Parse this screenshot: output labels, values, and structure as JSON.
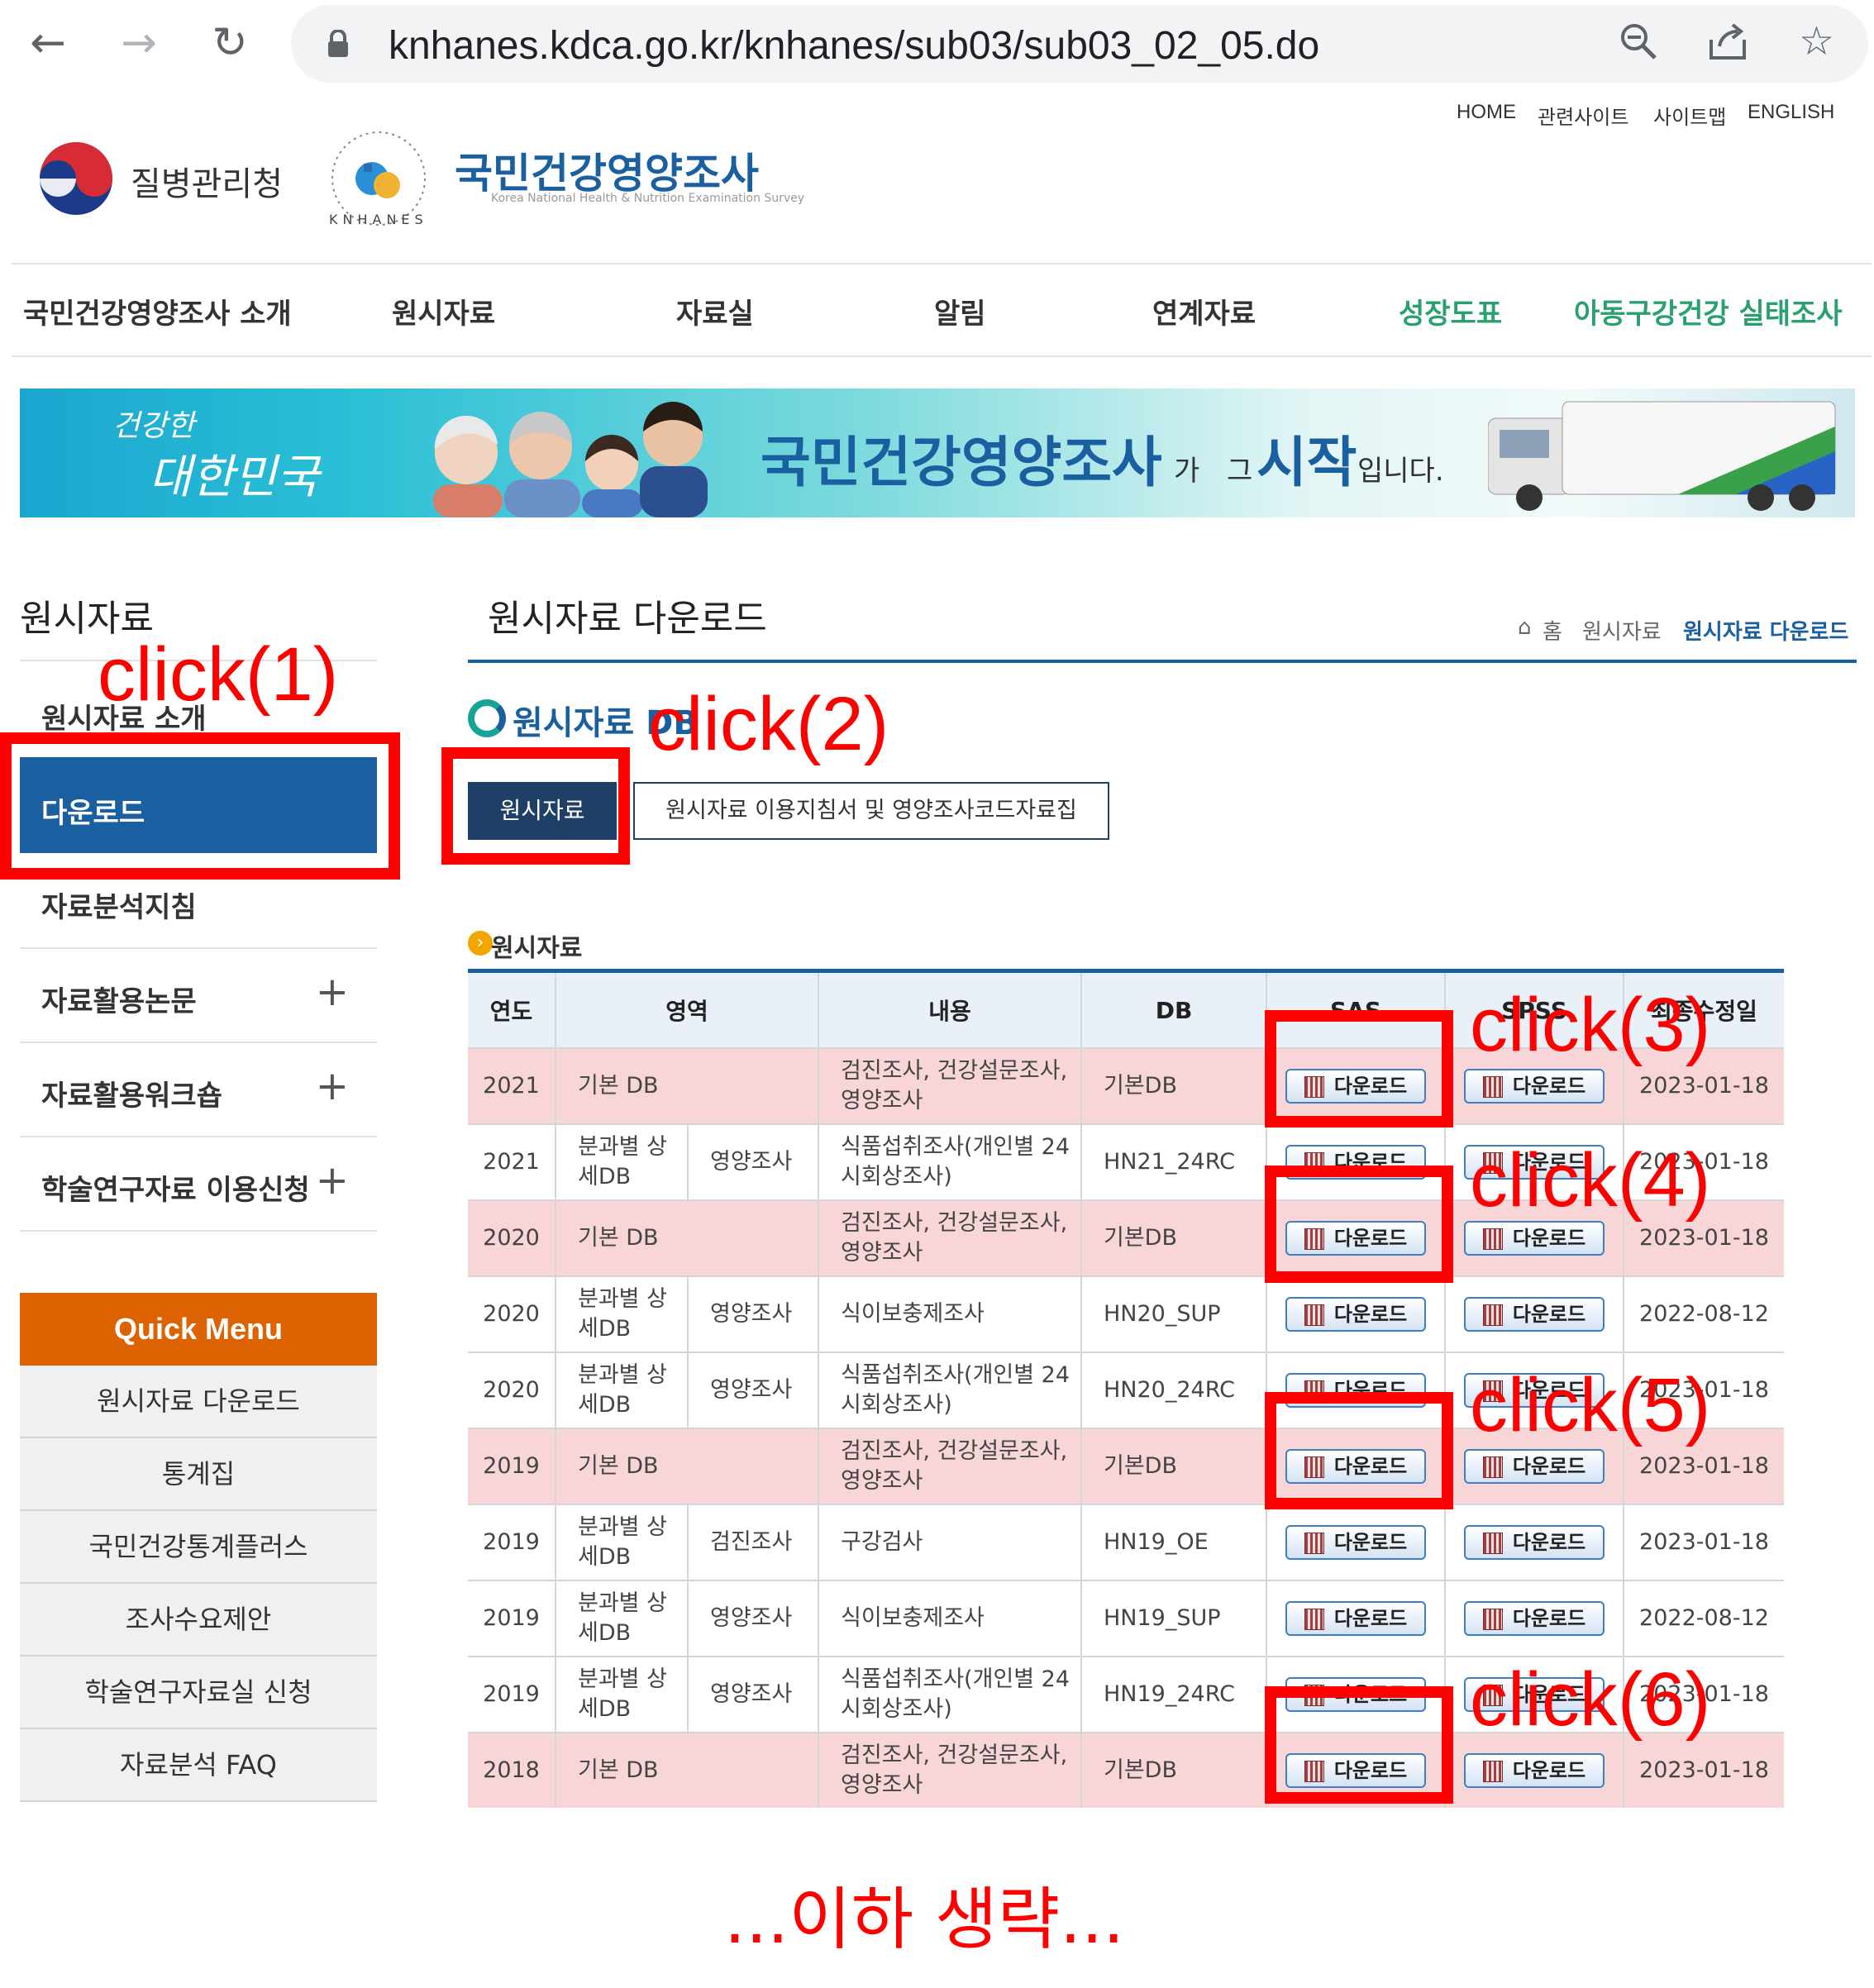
{
  "browser": {
    "url": "knhanes.kdca.go.kr/knhanes/sub03/sub03_02_05.do"
  },
  "header": {
    "util_links": [
      "HOME",
      "관련사이트",
      "사이트맵",
      "ENGLISH"
    ],
    "agency_name": "질병관리청",
    "site_title": "국민건강영양조사",
    "site_subtitle": "Korea National Health & Nutrition Examination Survey",
    "emblem_text": "KNHANES"
  },
  "gnb": [
    "국민건강영양조사 소개",
    "원시자료",
    "자료실",
    "알림",
    "연계자료",
    "성장도표",
    "아동구강건강 실태조사"
  ],
  "banner": {
    "slogan_small": "건강한",
    "slogan_big": "대한민국",
    "headline_main": "국민건강영양조사",
    "headline_a": "가",
    "headline_b": "그",
    "headline_c": "시작",
    "headline_d": "입니다."
  },
  "sidebar": {
    "title": "원시자료",
    "items": [
      {
        "label": "원시자료 소개"
      },
      {
        "label": "다운로드"
      },
      {
        "label": "자료분석지침"
      },
      {
        "label": "자료활용논문",
        "plus": "+"
      },
      {
        "label": "자료활용워크숍",
        "plus": "+"
      },
      {
        "label": "학술연구자료 이용신청",
        "plus": "+"
      }
    ],
    "quick_menu_title": "Quick Menu",
    "quick_menu": [
      "원시자료 다운로드",
      "통계집",
      "국민건강통계플러스",
      "조사수요제안",
      "학술연구자료실 신청",
      "자료분석 FAQ"
    ]
  },
  "main": {
    "title": "원시자료 다운로드",
    "breadcrumb": [
      "홈",
      "원시자료",
      "원시자료 다운로드"
    ],
    "section_title": "원시자료 DB",
    "tabs": [
      "원시자료",
      "원시자료 이용지침서 및 영양조사코드자료집"
    ],
    "table_title": "원시자료",
    "table": {
      "headers": [
        "연도",
        "영역",
        "내용",
        "DB",
        "SAS",
        "SPSS",
        "최종수정일"
      ],
      "download_label": "다운로드",
      "rows": [
        {
          "year": "2021",
          "area1": "기본 DB",
          "area2": "",
          "content": "검진조사, 건강설문조사, 영양조사",
          "db": "기본DB",
          "date": "2023-01-18",
          "hl": true
        },
        {
          "year": "2021",
          "area1": "분과별 상세DB",
          "area2": "영양조사",
          "content": "식품섭취조사(개인별 24시회상조사)",
          "db": "HN21_24RC",
          "date": "2023-01-18",
          "hl": false
        },
        {
          "year": "2020",
          "area1": "기본 DB",
          "area2": "",
          "content": "검진조사, 건강설문조사, 영양조사",
          "db": "기본DB",
          "date": "2023-01-18",
          "hl": true
        },
        {
          "year": "2020",
          "area1": "분과별 상세DB",
          "area2": "영양조사",
          "content": "식이보충제조사",
          "db": "HN20_SUP",
          "date": "2022-08-12",
          "hl": false
        },
        {
          "year": "2020",
          "area1": "분과별 상세DB",
          "area2": "영양조사",
          "content": "식품섭취조사(개인별 24시회상조사)",
          "db": "HN20_24RC",
          "date": "2023-01-18",
          "hl": false
        },
        {
          "year": "2019",
          "area1": "기본 DB",
          "area2": "",
          "content": "검진조사, 건강설문조사, 영양조사",
          "db": "기본DB",
          "date": "2023-01-18",
          "hl": true
        },
        {
          "year": "2019",
          "area1": "분과별 상세DB",
          "area2": "검진조사",
          "content": "구강검사",
          "db": "HN19_OE",
          "date": "2023-01-18",
          "hl": false
        },
        {
          "year": "2019",
          "area1": "분과별 상세DB",
          "area2": "영양조사",
          "content": "식이보충제조사",
          "db": "HN19_SUP",
          "date": "2022-08-12",
          "hl": false
        },
        {
          "year": "2019",
          "area1": "분과별 상세DB",
          "area2": "영양조사",
          "content": "식품섭취조사(개인별 24시회상조사)",
          "db": "HN19_24RC",
          "date": "2023-01-18",
          "hl": false
        },
        {
          "year": "2018",
          "area1": "기본 DB",
          "area2": "",
          "content": "검진조사, 건강설문조사, 영양조사",
          "db": "기본DB",
          "date": "2023-01-18",
          "hl": true
        }
      ]
    }
  },
  "annotations": {
    "click1": "click(1)",
    "click2": "click(2)",
    "click3": "click(3)",
    "click4": "click(4)",
    "click5": "click(5)",
    "click6": "click(6)",
    "omitted": "...이하 생략..."
  }
}
